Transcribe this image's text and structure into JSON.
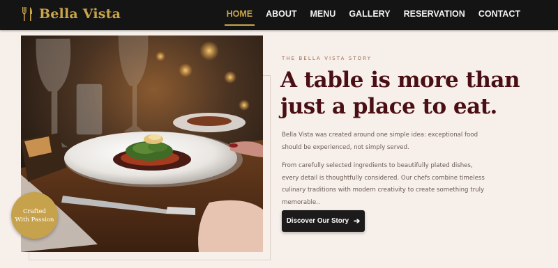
{
  "brand": {
    "name": "Bella Vista",
    "icon": "fork-knife-icon",
    "color": "#c9a54a"
  },
  "nav": {
    "items": [
      {
        "label": "HOME",
        "active": true
      },
      {
        "label": "ABOUT"
      },
      {
        "label": "MENU"
      },
      {
        "label": "GALLERY"
      },
      {
        "label": "RESERVATION"
      },
      {
        "label": "CONTACT"
      }
    ]
  },
  "story": {
    "eyebrow": "THE BELLA VISTA STORY",
    "headline_line1": "A table is more than",
    "headline_line2": "just a place to eat.",
    "paragraph1": "Bella Vista was created around one simple idea: exceptional food should be experienced, not simply served.",
    "paragraph2": "From carefully selected ingredients to beautifully plated dishes, every detail is thoughtfully considered. Our chefs combine timeless culinary traditions with modern creativity to create something truly memorable..",
    "cta_label": "Discover Our Story",
    "cta_icon": "arrow-right-icon"
  },
  "badge": {
    "line1": "Crafted",
    "line2": "With Passion"
  },
  "colors": {
    "accent": "#c9a54a",
    "headline": "#4a0f14",
    "background": "#f6efea",
    "nav": "#151414"
  }
}
